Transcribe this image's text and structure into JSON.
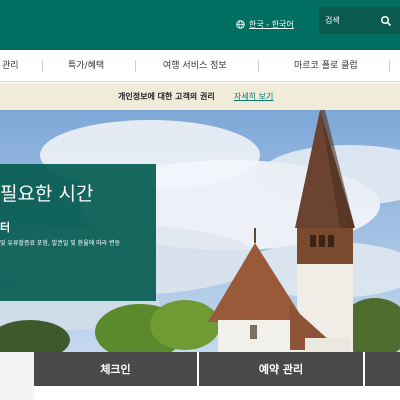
{
  "header": {
    "language": "한국 - 한국어",
    "search_placeholder": "검색"
  },
  "nav": {
    "items": [
      "관리",
      "특가/혜택",
      "여행 서비스 정보",
      "마르코 폴로 클럽"
    ]
  },
  "notice": {
    "text": "개인정보에 대한 고객의 권리",
    "link": "자세히 보기"
  },
  "promo": {
    "title": "필요한 시간",
    "subtitle": "터",
    "description": "및 유류할증료 포함, 발권일 및 환율에 따라 변동"
  },
  "tabs": {
    "checkin": "체크인",
    "manage": "예약 관리"
  },
  "colors": {
    "brand": "#006f62",
    "notice_bg": "#f1ebd9",
    "tab_bg": "#4a4a4a"
  },
  "icons": {
    "language": "globe-icon",
    "search": "search-icon"
  }
}
